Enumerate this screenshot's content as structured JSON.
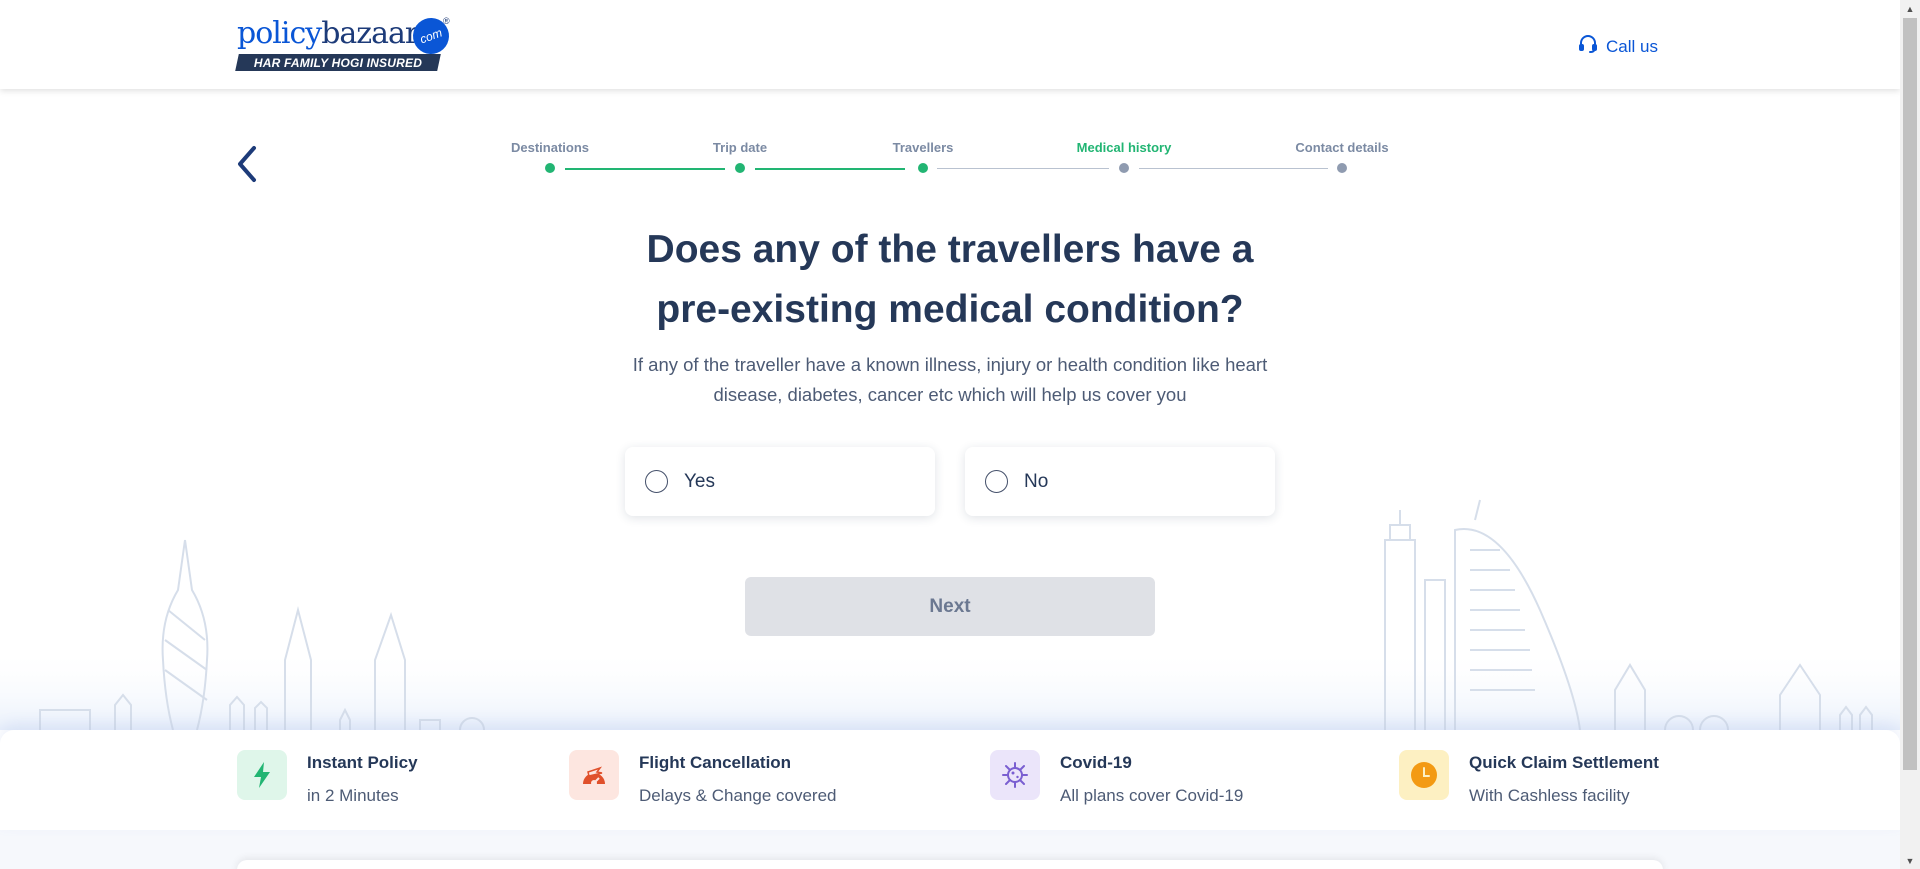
{
  "header": {
    "logo_policy": "policy",
    "logo_bazaar": "bazaar",
    "logo_com": "com",
    "logo_reg": "®",
    "logo_tagline": "HAR FAMILY HOGI INSURED",
    "call_label": "Call us"
  },
  "stepper": {
    "steps": [
      {
        "label": "Destinations",
        "state": "done"
      },
      {
        "label": "Trip date",
        "state": "done"
      },
      {
        "label": "Travellers",
        "state": "done"
      },
      {
        "label": "Medical history",
        "state": "active"
      },
      {
        "label": "Contact details",
        "state": "pending"
      }
    ]
  },
  "question": {
    "title_line1": "Does any of the travellers have a",
    "title_line2": "pre-existing medical condition?",
    "subtitle_line1": "If any of the traveller have a known illness, injury or health condition like heart",
    "subtitle_line2": "disease, diabetes, cancer etc which will help us cover you",
    "options": [
      {
        "label": "Yes",
        "selected": false
      },
      {
        "label": "No",
        "selected": false
      }
    ],
    "next_label": "Next"
  },
  "features": [
    {
      "title": "Instant Policy",
      "subtitle": "in 2 Minutes",
      "icon": "lightning-icon",
      "color": "#22b573"
    },
    {
      "title": "Flight Cancellation",
      "subtitle": "Delays & Change covered",
      "icon": "flight-cancel-icon",
      "color": "#e0502b"
    },
    {
      "title": "Covid-19",
      "subtitle": "All plans cover Covid-19",
      "icon": "virus-icon",
      "color": "#7a5fd1"
    },
    {
      "title": "Quick Claim Settlement",
      "subtitle": "With Cashless facility",
      "icon": "clock-icon",
      "color": "#f39a13"
    }
  ],
  "colors": {
    "primary_blue": "#0a56d6",
    "navy": "#253858",
    "green": "#22b573",
    "disabled_button": "#dfe1e6"
  }
}
